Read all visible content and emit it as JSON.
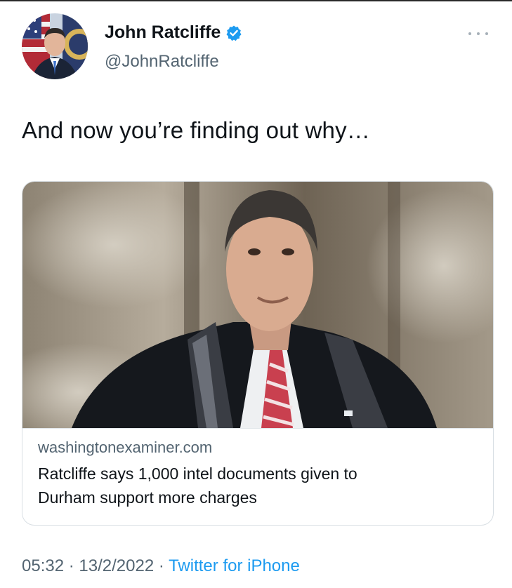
{
  "author": {
    "display_name": "John Ratcliffe",
    "handle": "@JohnRatcliffe",
    "verified": true,
    "avatar_icon": "profile-photo"
  },
  "tweet": {
    "text": "And now you’re finding out why…"
  },
  "card": {
    "image_icon": "news-photo",
    "domain": "washingtonexaminer.com",
    "title_line1": "Ratcliffe says 1,000 intel documents given to",
    "title_line2": "Durham support more charges"
  },
  "meta": {
    "time": "05:32",
    "separator": "·",
    "date": "13/2/2022",
    "source": "Twitter for iPhone"
  },
  "colors": {
    "text_primary": "#0f1419",
    "text_secondary": "#536471",
    "accent": "#1d9bf0",
    "border": "#d9dfe4"
  }
}
